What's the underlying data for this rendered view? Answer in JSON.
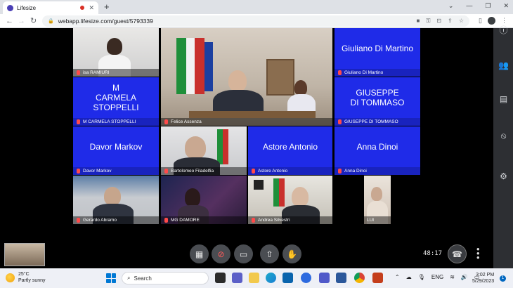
{
  "browser": {
    "tab_title": "Lifesize",
    "new_tab_symbol": "+",
    "url": "webapp.lifesize.com/guest/5793339",
    "controls": {
      "minimize": "—",
      "restore": "❐",
      "close": "✕",
      "chevron": "⌄"
    }
  },
  "participants": [
    {
      "name": "isa RAMIURI",
      "kind": "video"
    },
    {
      "name": "Felice Assenza",
      "kind": "video-main"
    },
    {
      "name": "Giuliano Di Martino",
      "display": "Giuliano Di Martino",
      "kind": "avatar"
    },
    {
      "name": "M CARMELA STOPPELLI",
      "display": "M\nCARMELA STOPPELLI",
      "kind": "avatar"
    },
    {
      "name": "GIUSEPPE DI TOMMASO",
      "display": "GIUSEPPE\nDI TOMMASO",
      "kind": "avatar"
    },
    {
      "name": "Davor Markov",
      "display": "Davor Markov",
      "kind": "avatar"
    },
    {
      "name": "Bartolomeo Filadelfia",
      "kind": "video"
    },
    {
      "name": "Astore Antonio",
      "display": "Astore Antonio",
      "kind": "avatar"
    },
    {
      "name": "Anna Dinoi",
      "display": "Anna Dinoi",
      "kind": "avatar"
    },
    {
      "name": "Gerardo Abramo",
      "kind": "video"
    },
    {
      "name": "MG DAMORE",
      "kind": "video"
    },
    {
      "name": "Andrea Silvestri",
      "kind": "video"
    },
    {
      "name": "LUI",
      "kind": "video"
    }
  ],
  "call": {
    "timer": "48:17"
  },
  "taskbar": {
    "temperature": "25°C",
    "condition": "Partly sunny",
    "search_label": "Search",
    "language": "ENG",
    "time": "3:02 PM",
    "date": "5/29/2023",
    "notification_count": "1"
  }
}
